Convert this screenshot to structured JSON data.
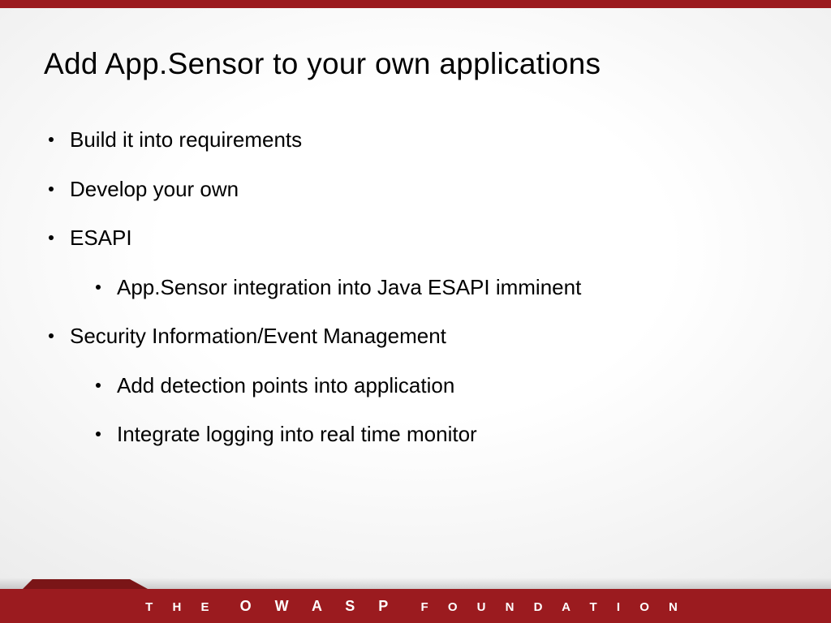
{
  "title": "Add App.Sensor to your own applications",
  "bullets": [
    {
      "text": "Build it into requirements",
      "level": 1
    },
    {
      "text": "Develop your own",
      "level": 1
    },
    {
      "text": "ESAPI",
      "level": 1
    },
    {
      "text": "App.Sensor integration into Java ESAPI imminent",
      "level": 2
    },
    {
      "text": "Security Information/Event Management",
      "level": 1
    },
    {
      "text": "Add detection points into application",
      "level": 2
    },
    {
      "text": "Integrate logging into real time monitor",
      "level": 2
    }
  ],
  "footer": {
    "left": "T H E",
    "center": "O W A S P",
    "right": "F O U N D A T I O N"
  },
  "colors": {
    "brand": "#9b1b1f",
    "brand_dark": "#7a1517"
  }
}
